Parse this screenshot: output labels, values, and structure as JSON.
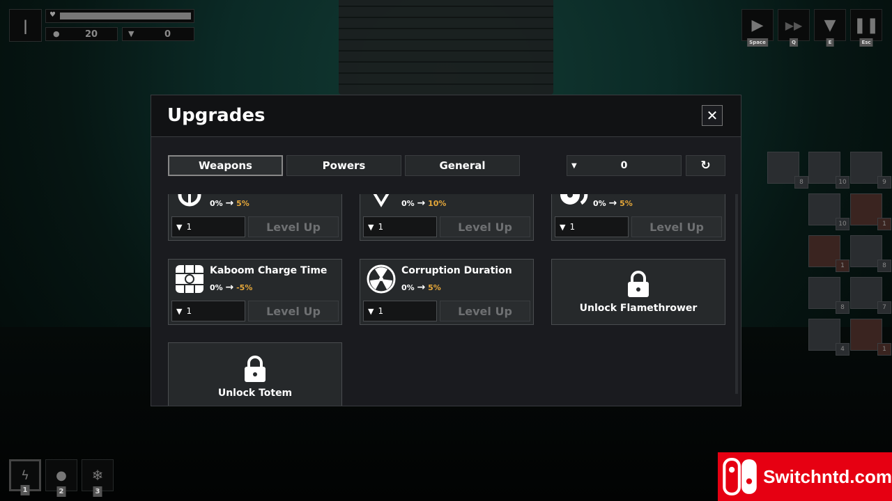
{
  "hud": {
    "pause_glyph": "|",
    "coins": "20",
    "anvils": "0",
    "health_fraction": 1.0,
    "controls": [
      {
        "icon": "play-icon",
        "key": "Space"
      },
      {
        "icon": "fast-forward-icon",
        "key": "Q"
      },
      {
        "icon": "anvil-icon",
        "key": "E"
      },
      {
        "icon": "pause-icon",
        "key": "Esc"
      }
    ],
    "abilities": [
      {
        "icon": "lightning-icon",
        "key": "1"
      },
      {
        "icon": "bomb-icon",
        "key": "2"
      },
      {
        "icon": "snowflake-icon",
        "key": "3"
      }
    ],
    "enemies": [
      "8",
      "10",
      "9",
      "10",
      "1",
      "1",
      "8",
      "8",
      "7",
      "4",
      "1"
    ]
  },
  "modal": {
    "title": "Upgrades",
    "close": "✕",
    "tabs": [
      "Weapons",
      "Powers",
      "General"
    ],
    "currency": "0",
    "reset": "↻",
    "cards": [
      {
        "title": "",
        "from": "0%",
        "arrow": "→",
        "to": "5%",
        "cost": "1",
        "button": "Level Up"
      },
      {
        "title": "",
        "from": "0%",
        "arrow": "→",
        "to": "10%",
        "cost": "1",
        "button": "Level Up"
      },
      {
        "title": "",
        "from": "0%",
        "arrow": "→",
        "to": "5%",
        "cost": "1",
        "button": "Level Up"
      },
      {
        "title": "Kaboom Charge Time",
        "from": "0%",
        "arrow": "→",
        "to": "-5%",
        "cost": "1",
        "button": "Level Up"
      },
      {
        "title": "Corruption Duration",
        "from": "0%",
        "arrow": "→",
        "to": "5%",
        "cost": "1",
        "button": "Level Up"
      }
    ],
    "locked": [
      "Unlock Flamethrower",
      "Unlock Totem"
    ]
  },
  "watermark": "Switchntd.com",
  "colors": {
    "accent": "#e6a83a",
    "watermark": "#e60012"
  }
}
